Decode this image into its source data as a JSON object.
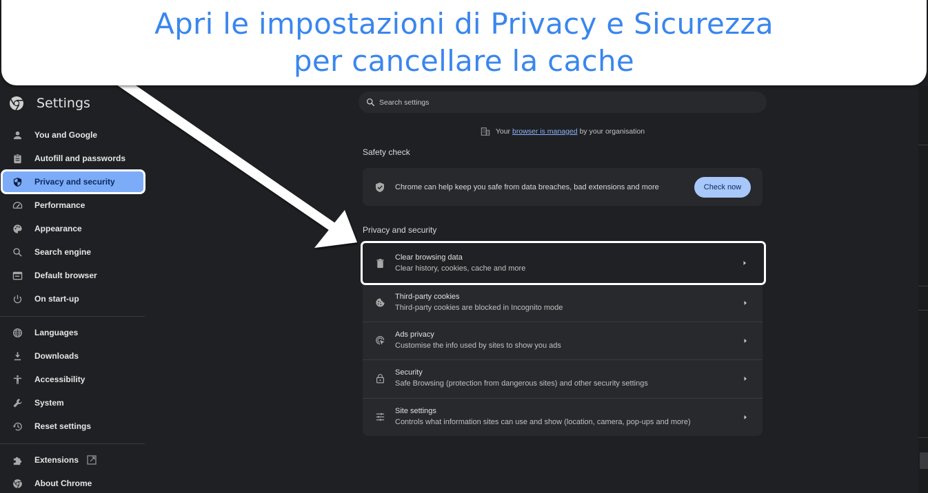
{
  "banner": {
    "line1": "Apri le impostazioni di Privacy e Sicurezza",
    "line2": "per cancellare la cache",
    "color": "#3a86ee"
  },
  "sidebar": {
    "title": "Settings",
    "logo_icon": "chrome-logo-icon",
    "groups": [
      [
        {
          "label": "You and Google",
          "icon": "person-icon"
        },
        {
          "label": "Autofill and passwords",
          "icon": "clipboard-icon"
        },
        {
          "label": "Privacy and security",
          "icon": "shield-icon",
          "active": true
        },
        {
          "label": "Performance",
          "icon": "speedometer-icon"
        },
        {
          "label": "Appearance",
          "icon": "palette-icon"
        },
        {
          "label": "Search engine",
          "icon": "search-icon"
        },
        {
          "label": "Default browser",
          "icon": "browser-window-icon"
        },
        {
          "label": "On start-up",
          "icon": "power-icon"
        }
      ],
      [
        {
          "label": "Languages",
          "icon": "globe-icon"
        },
        {
          "label": "Downloads",
          "icon": "download-icon"
        },
        {
          "label": "Accessibility",
          "icon": "accessibility-icon"
        },
        {
          "label": "System",
          "icon": "wrench-icon"
        },
        {
          "label": "Reset settings",
          "icon": "history-reset-icon"
        }
      ],
      [
        {
          "label": "Extensions",
          "icon": "puzzle-icon",
          "external": true
        },
        {
          "label": "About Chrome",
          "icon": "chrome-logo-icon"
        }
      ]
    ]
  },
  "search": {
    "placeholder": "Search settings"
  },
  "managed_notice": {
    "prefix": "Your",
    "link": "browser is managed",
    "suffix": "by your organisation"
  },
  "safety_check": {
    "title": "Safety check",
    "text": "Chrome can help keep you safe from data breaches, bad extensions and more",
    "button": "Check now",
    "button_color": "#a8c7fa"
  },
  "privacy_section": {
    "title": "Privacy and security",
    "rows": [
      {
        "title": "Clear browsing data",
        "subtitle": "Clear history, cookies, cache and more",
        "icon": "trash-icon",
        "highlighted": true
      },
      {
        "title": "Third-party cookies",
        "subtitle": "Third-party cookies are blocked in Incognito mode",
        "icon": "cookie-icon"
      },
      {
        "title": "Ads privacy",
        "subtitle": "Customise the info used by sites to show you ads",
        "icon": "ads-target-icon"
      },
      {
        "title": "Security",
        "subtitle": "Safe Browsing (protection from dangerous sites) and other security settings",
        "icon": "lock-icon"
      },
      {
        "title": "Site settings",
        "subtitle": "Controls what information sites can use and show (location, camera, pop-ups and more)",
        "icon": "sliders-icon"
      }
    ]
  },
  "colors": {
    "background": "#1f2023",
    "card": "#28292c",
    "active_nav": "#7cacf8",
    "link": "#8ab4f8"
  }
}
